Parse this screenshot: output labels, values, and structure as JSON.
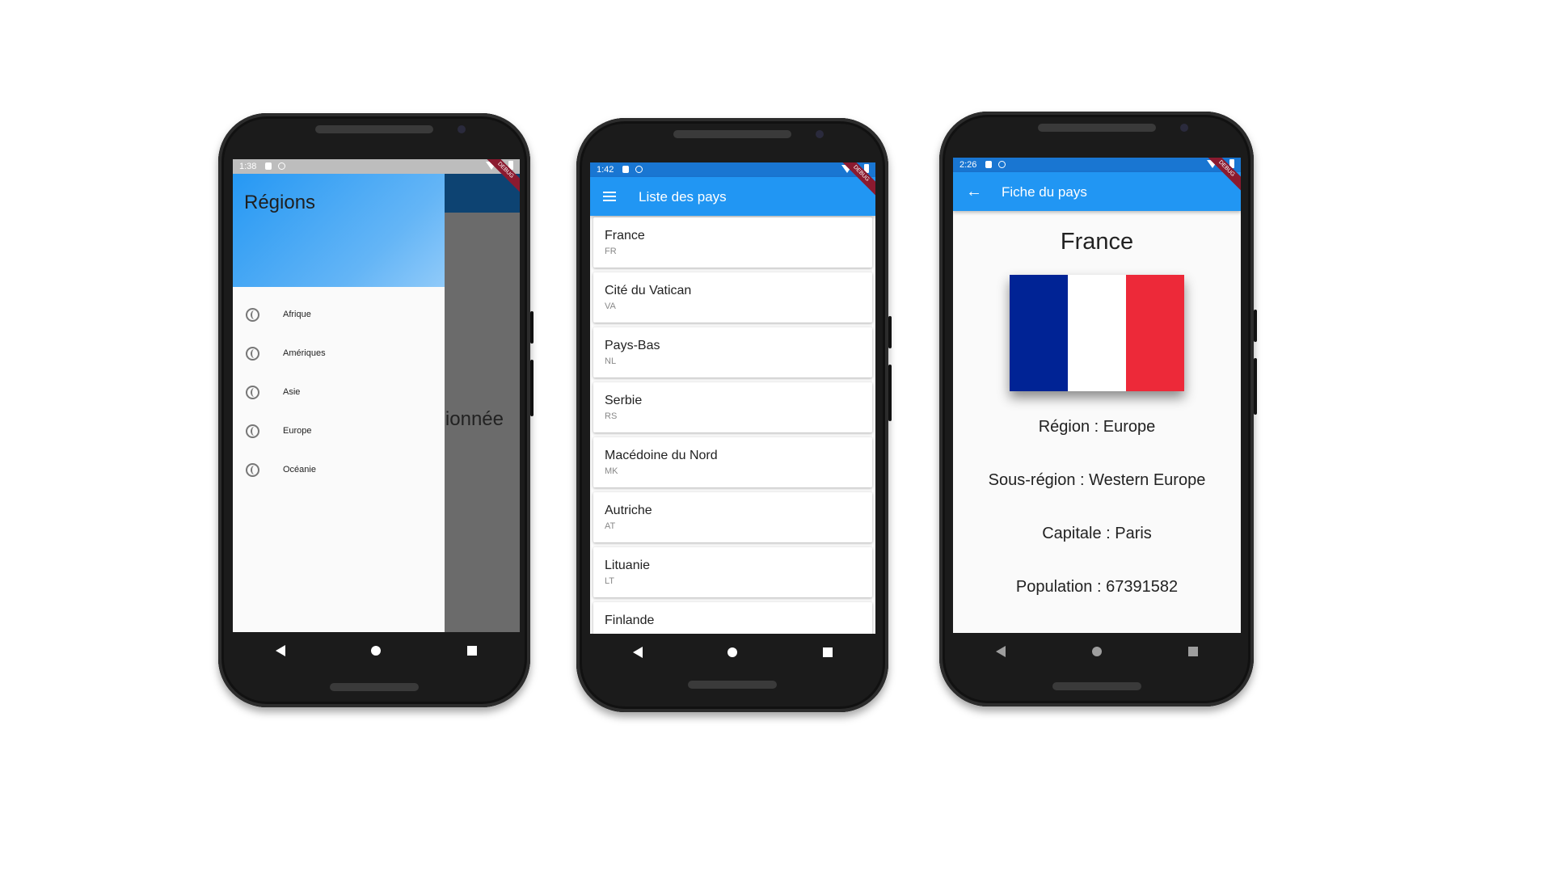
{
  "colors": {
    "primary": "#2196f3",
    "drawer_scrim": "#6b6b6b",
    "flag_blue": "#002395",
    "flag_white": "#ffffff",
    "flag_red": "#ed2939"
  },
  "phone1": {
    "status_time": "1:38",
    "debug_banner": "DEBUG",
    "drawer": {
      "header": "Régions",
      "items": [
        {
          "label": "Afrique",
          "icon": "globe-icon"
        },
        {
          "label": "Amériques",
          "icon": "globe-icon"
        },
        {
          "label": "Asie",
          "icon": "globe-icon"
        },
        {
          "label": "Europe",
          "icon": "globe-icon"
        },
        {
          "label": "Océanie",
          "icon": "globe-icon"
        }
      ]
    },
    "behind_text": "ionnée"
  },
  "phone2": {
    "status_time": "1:42",
    "debug_banner": "DEBUG",
    "appbar_title": "Liste des pays",
    "countries": [
      {
        "name": "France",
        "code": "FR"
      },
      {
        "name": "Cité du Vatican",
        "code": "VA"
      },
      {
        "name": "Pays-Bas",
        "code": "NL"
      },
      {
        "name": "Serbie",
        "code": "RS"
      },
      {
        "name": "Macédoine du Nord",
        "code": "MK"
      },
      {
        "name": "Autriche",
        "code": "AT"
      },
      {
        "name": "Lituanie",
        "code": "LT"
      },
      {
        "name": "Finlande",
        "code": ""
      }
    ]
  },
  "phone3": {
    "status_time": "2:26",
    "debug_banner": "DEBUG",
    "appbar_title": "Fiche du pays",
    "country_name": "France",
    "region": "Région : Europe",
    "subregion": "Sous-région : Western Europe",
    "capital": "Capitale : Paris",
    "population": "Population : 67391582"
  }
}
